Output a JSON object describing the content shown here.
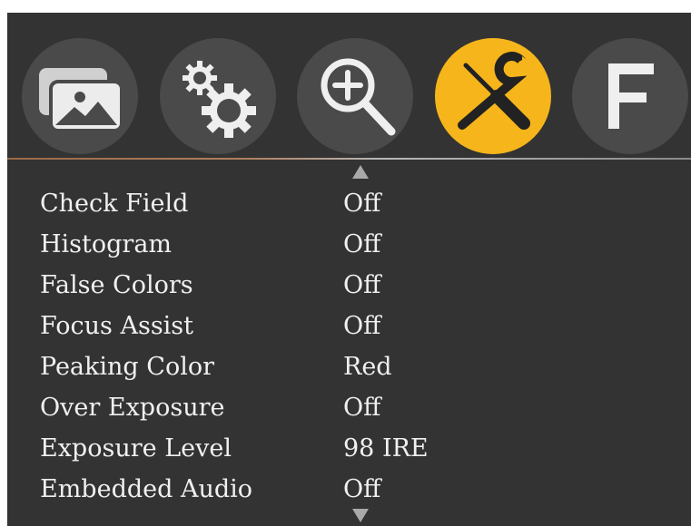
{
  "theme": {
    "background": "#333333",
    "tab_background": "#4a4a4a",
    "accent": "#f6b51b",
    "text": "#f0f0f0"
  },
  "tabs": [
    {
      "icon": "image-icon",
      "active": false
    },
    {
      "icon": "gears-icon",
      "active": false
    },
    {
      "icon": "zoom-in-icon",
      "active": false
    },
    {
      "icon": "tools-icon",
      "active": true
    },
    {
      "icon": "function-f-icon",
      "active": false,
      "glyph": "F"
    }
  ],
  "menu": {
    "items": [
      {
        "label": "Check Field",
        "value": "Off"
      },
      {
        "label": "Histogram",
        "value": "Off"
      },
      {
        "label": "False Colors",
        "value": "Off"
      },
      {
        "label": "Focus Assist",
        "value": "Off"
      },
      {
        "label": "Peaking Color",
        "value": "Red"
      },
      {
        "label": "Over Exposure",
        "value": "Off"
      },
      {
        "label": "Exposure Level",
        "value": "98 IRE"
      },
      {
        "label": "Embedded Audio",
        "value": "Off"
      }
    ]
  }
}
